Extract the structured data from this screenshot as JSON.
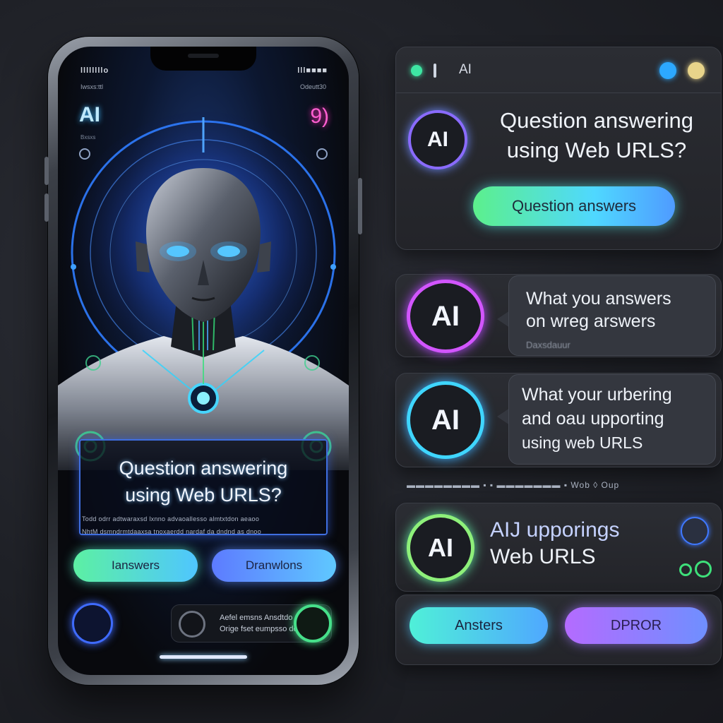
{
  "phone": {
    "status_left": "llllllllo",
    "status_right": "lll■■■■",
    "sub_left": "Iwsxs:ttl",
    "sub_right": "Odeutt30",
    "logo": "AI",
    "logo_sub": "Bxsxs",
    "top_right_num": "9)",
    "caption_title_line1": "Question answering",
    "caption_title_line2": "using Web URLS?",
    "fine_print_1": "Todd odrr adtwaraxsd lxnno advaoallesso almtxtdon aeaoo",
    "fine_print_2": "NhtM dsmndrmtdaaxsa tnoxaerdd nardaf da dndnd as dnoo",
    "btn_answers": "Ianswers",
    "btn_downloads": "Dranwlons",
    "info_line1": "Aefel emsns Ansdtdo no",
    "info_line2": "Orige fset eumpsso dolre"
  },
  "panels": {
    "top_bar_label": "AI",
    "card1": {
      "badge": "AI",
      "title_line1": "Question answering",
      "title_line2": "using  Web URLS?",
      "button": "Question answers"
    },
    "card2": {
      "badge": "AI",
      "line1": "What you answers",
      "line2": "on wreg arswers",
      "line3": "Daxsdauur"
    },
    "card3": {
      "badge": "AI",
      "line1": "What your urbering",
      "line2": "and oau upporting",
      "line3": "using web URLS"
    },
    "dash_row": "▬▬▬▬▬▬▬▬ ▪ ▪ ▬▬▬▬▬▬▬ ▪ Wob ◊ Oup",
    "card4": {
      "badge": "AI",
      "line1": "AIJ upporings",
      "line2": "Web URLS"
    },
    "bottom": {
      "btn_left": "Ansters",
      "btn_right": "DPROR"
    }
  },
  "colors": {
    "accent_blue": "#3fa0ff",
    "accent_green": "#5cf0a3",
    "accent_pink": "#ff4fd0",
    "accent_purple": "#b46bff"
  }
}
